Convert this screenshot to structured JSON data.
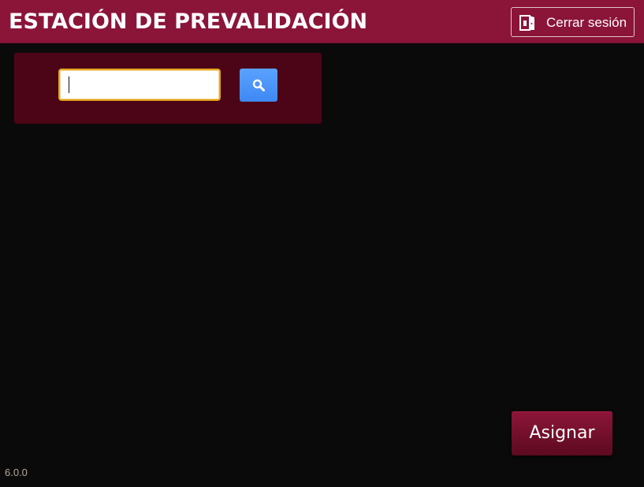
{
  "header": {
    "title": "ESTACIÓN DE PREVALIDACIÓN",
    "logout_label": "Cerrar sesión",
    "logout_icon": "door-exit-icon"
  },
  "search": {
    "value": "",
    "placeholder": "",
    "button_icon": "search-icon"
  },
  "actions": {
    "assign_label": "Asignar"
  },
  "footer": {
    "version": "6.0.0"
  },
  "colors": {
    "header_bg": "#8b1439",
    "panel_bg": "#4c0417",
    "page_bg": "#0b0a0a",
    "input_border": "#e3a51e",
    "search_button": "#4a92fa",
    "assign_button": "#7a1130"
  }
}
